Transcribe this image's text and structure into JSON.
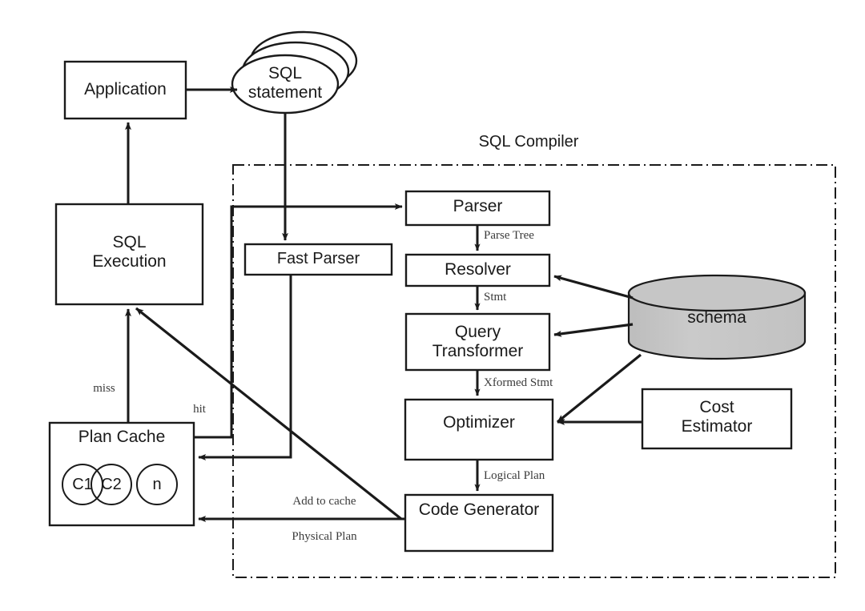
{
  "diagram": {
    "title": "SQL Compiler",
    "colors": {
      "stroke": "#1a1a1a",
      "background": "#ffffff",
      "schema_fill": "#c6c6c6",
      "edge_label": "#3b3b3b"
    },
    "nodes": {
      "application": {
        "label": "Application",
        "shape": "rectangle"
      },
      "sql_statement": {
        "label": "SQL\nstatement",
        "shape": "stacked-ellipse"
      },
      "sql_execution": {
        "label": "SQL\nExecution",
        "shape": "rectangle"
      },
      "plan_cache": {
        "label": "Plan Cache",
        "shape": "rectangle"
      },
      "plan_cache_entries": [
        {
          "label": "C1",
          "shape": "circle"
        },
        {
          "label": "C2",
          "shape": "circle"
        },
        {
          "label": "n",
          "shape": "circle"
        }
      ],
      "fast_parser": {
        "label": "Fast Parser",
        "shape": "rectangle"
      },
      "parser": {
        "label": "Parser",
        "shape": "rectangle"
      },
      "resolver": {
        "label": "Resolver",
        "shape": "rectangle"
      },
      "query_transformer": {
        "label": "Query\nTransformer",
        "shape": "rectangle"
      },
      "optimizer": {
        "label": "Optimizer",
        "shape": "rectangle"
      },
      "code_generator": {
        "label": "Code Generator",
        "shape": "rectangle"
      },
      "cost_estimator": {
        "label": "Cost\nEstimator",
        "shape": "rectangle"
      },
      "schema": {
        "label": "schema",
        "shape": "cylinder"
      }
    },
    "edge_labels": {
      "parse_tree": "Parse Tree",
      "stmt": "Stmt",
      "xformed_stmt": "Xformed Stmt",
      "logical_plan": "Logical Plan",
      "miss": "miss",
      "hit": "hit",
      "add_to_cache": "Add to cache",
      "physical_plan": "Physical Plan"
    }
  }
}
